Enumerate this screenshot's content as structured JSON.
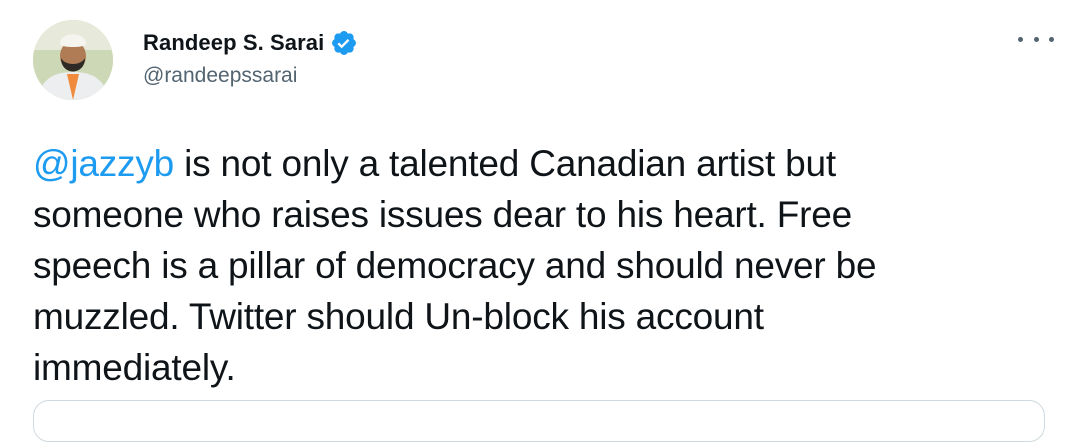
{
  "author": {
    "display_name": "Randeep S. Sarai",
    "handle": "@randeepssarai",
    "verified": true
  },
  "tweet": {
    "mention": "@jazzyb",
    "line1_rest": " is not only a talented Canadian artist but",
    "line2": "someone who raises issues dear to his heart. Free",
    "line3": "speech is a pillar of democracy and should never be",
    "line4": "muzzled. Twitter should Un-block his account",
    "line5": "immediately."
  },
  "icons": {
    "verified": "verified-badge-icon",
    "more": "more-options-icon"
  },
  "colors": {
    "accent": "#1d9bf0",
    "text": "#0f1419",
    "secondary_text": "#536471"
  }
}
